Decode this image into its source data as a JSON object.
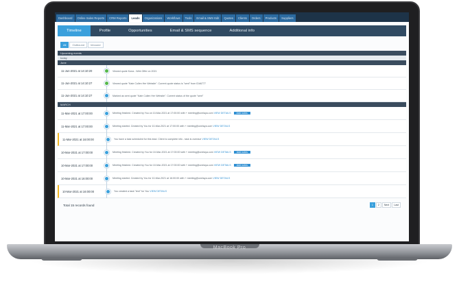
{
  "device_label": "MacBook Pro",
  "top_nav": [
    "Dashboard",
    "Online Sales Reports",
    "CRM Reports",
    "Leads",
    "Organizations",
    "Workflows",
    "Tools",
    "Email & SMS Edit",
    "Quotes",
    "Clients",
    "Orders",
    "Products",
    "Suppliers"
  ],
  "top_nav_active": "Leads",
  "tabs": [
    "Timeline",
    "Profile",
    "Opportunities",
    "Email & SMS sequence",
    "Additional info"
  ],
  "tabs_active": "Timeline",
  "filters": [
    "All",
    "Outbound",
    "Inbound"
  ],
  "filters_active": "All",
  "sections": {
    "upcoming": "Upcoming events",
    "today": "today",
    "june": "June",
    "march": "MARCH"
  },
  "rows_june": [
    {
      "date": "11-Jun-2021 at 14:10:20",
      "icon": "check-icon",
      "color": "green",
      "text": "Viewed quote Kona - Web Offer on 2021"
    },
    {
      "date": "11-Jun-2021 at 14:10:27",
      "icon": "check-icon",
      "color": "green",
      "text": "Viewed quote \"Kate Cullen Her Website\". Current quote status is \"sent\" from ID#6777"
    },
    {
      "date": "11-Jun-2021 at 14:10:27",
      "icon": "doc-icon",
      "color": "blue",
      "text": "Marked as sent quote \"Kate Cullen Her Website\". Current status of the quote \"sent\""
    }
  ],
  "rows_march": [
    {
      "date": "11-Mar-2021 at 17:00:00",
      "icon": "calendar-icon",
      "color": "blue",
      "warn": false,
      "text": "Meeting finished. Created by You on 10-Mar-2021 at 17:00:00 with + meeting@unelaya.com",
      "link": "VIEW DETAILS",
      "button": "Add notes"
    },
    {
      "date": "11-Mar-2021 at 17:00:00",
      "icon": "calendar-icon",
      "color": "blue",
      "warn": false,
      "text": "Meeting started. Created by You for 10-Mar-2021 at 17:00:00 with + meeting@unelaya.com",
      "link": "VIEW DETAILS",
      "button": ""
    },
    {
      "date": "11-Mar-2021 at 16:00:00",
      "icon": "phone-icon",
      "color": "blue",
      "warn": true,
      "text": "You have a task scheduled for this lead. Client to complete info - task is overdue",
      "link": "VIEW DETAILS",
      "button": ""
    },
    {
      "date": "10-Mar-2021 at 17:00:00",
      "icon": "calendar-icon",
      "color": "blue",
      "warn": false,
      "text": "Meeting finished. Created by You for 10-Mar-2021 at 17:00:00 with + meeting@unelaya.com",
      "link": "VIEW DETAILS",
      "button": "Add notes"
    },
    {
      "date": "10-Mar-2021 at 17:00:00",
      "icon": "calendar-icon",
      "color": "blue",
      "warn": false,
      "text": "Meeting finished. Created by You for 10-Mar-2021 at 17:00:00 with + meeting@unelaya.com",
      "link": "VIEW DETAILS",
      "button": "Add notes"
    },
    {
      "date": "10-Mar-2021 at 16:00:00",
      "icon": "calendar-icon",
      "color": "blue",
      "warn": false,
      "text": "Meeting started. Created by You for 10-Mar-2021 at 16:00:00 with + meeting@unelaya.com",
      "link": "VIEW DETAILS",
      "button": ""
    },
    {
      "date": "10-Mar-2021 at 16:00:00",
      "icon": "phone-icon",
      "color": "blue",
      "warn": true,
      "text": "You created a task \"test\" for You",
      "link": "VIEW DETAILS",
      "button": ""
    }
  ],
  "footer": {
    "total": "Total 15 records found",
    "pages": [
      "1",
      "2",
      "Next",
      "Last"
    ],
    "page_active": "1"
  },
  "colors": {
    "nav_bg": "#1d3348",
    "accent": "#3aa0dc",
    "success": "#55b84a",
    "warning": "#f2b623"
  }
}
